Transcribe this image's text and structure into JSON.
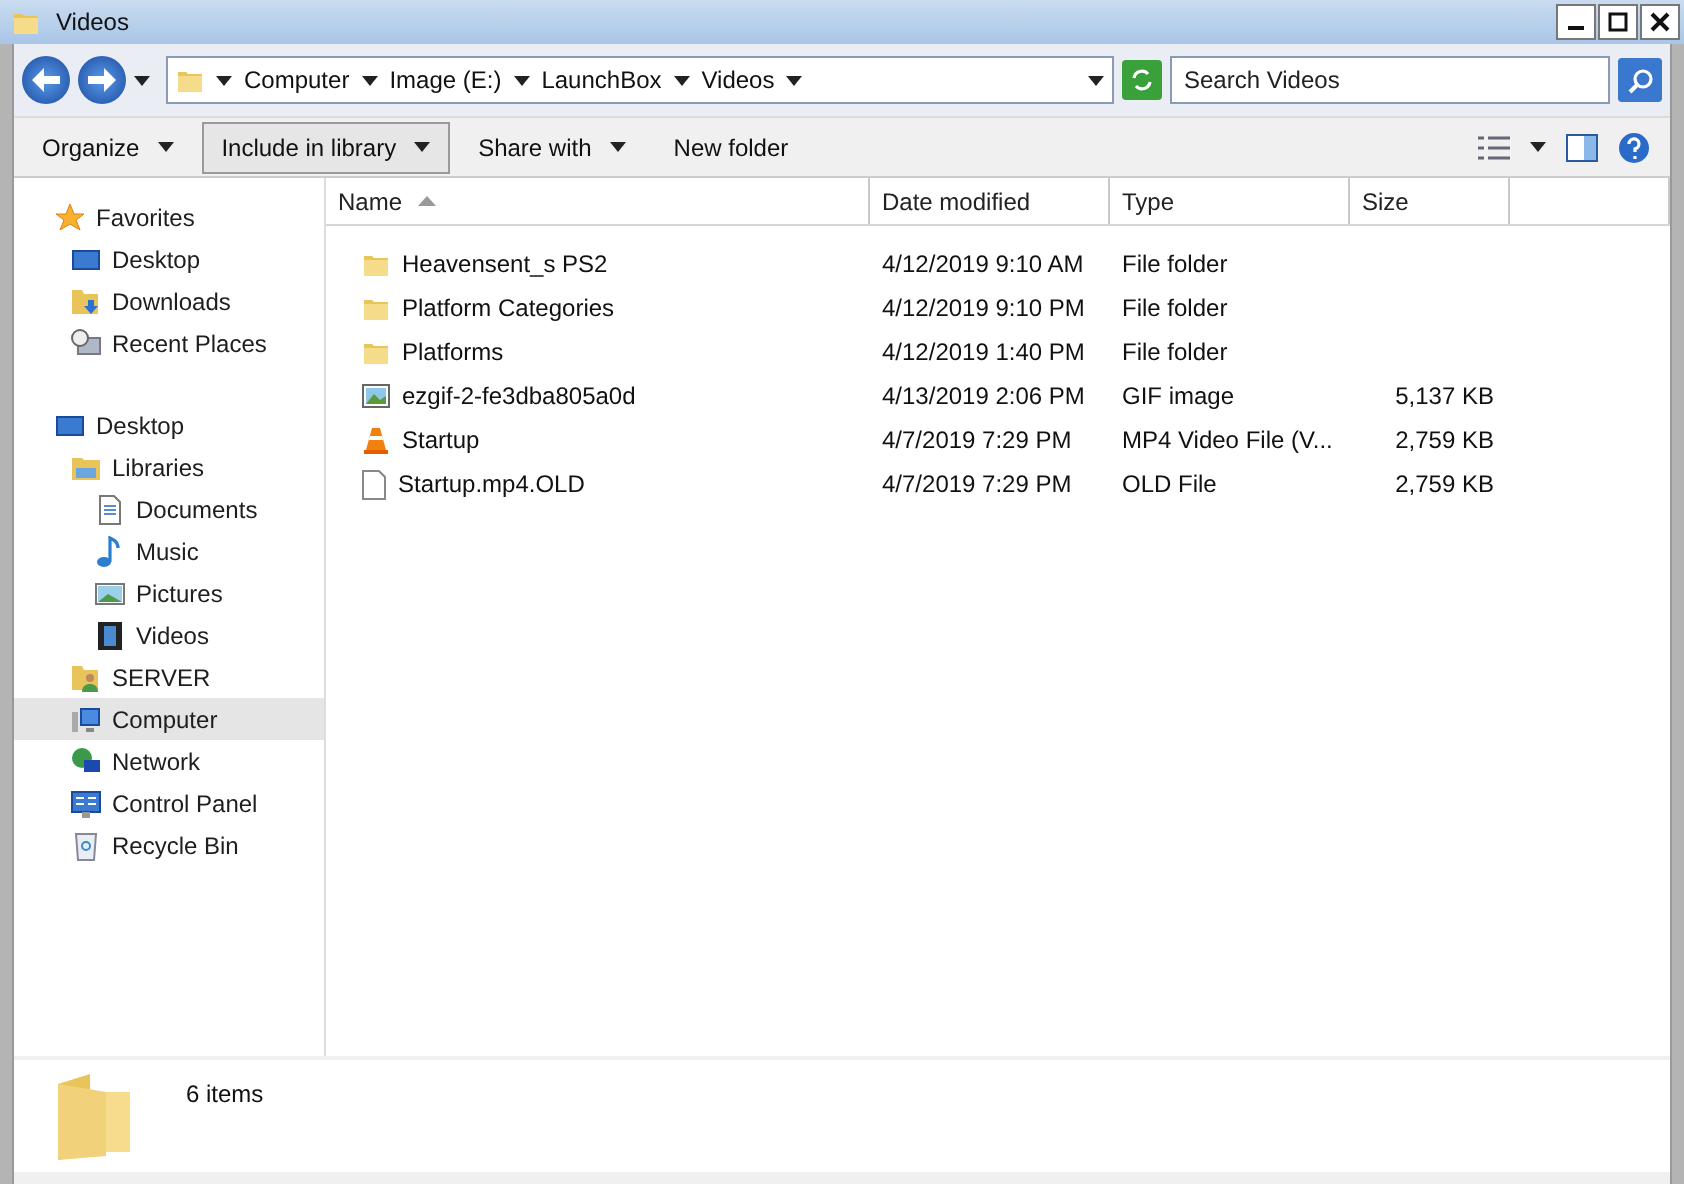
{
  "window": {
    "title": "Videos"
  },
  "address": {
    "crumbs": [
      "Computer",
      "Image (E:)",
      "LaunchBox",
      "Videos"
    ]
  },
  "search": {
    "placeholder": "Search Videos"
  },
  "toolbar": [
    {
      "label": "Organize",
      "menu": true,
      "selected": false
    },
    {
      "label": "Include in library",
      "menu": true,
      "selected": true
    },
    {
      "label": "Share with",
      "menu": true,
      "selected": false
    },
    {
      "label": "New folder",
      "menu": false,
      "selected": false
    }
  ],
  "sidebar": {
    "groups": [
      {
        "label": "Favorites",
        "kind": "star",
        "selected": false,
        "children": [
          {
            "label": "Desktop",
            "kind": "desktop",
            "selected": false
          },
          {
            "label": "Downloads",
            "kind": "downloads",
            "selected": false
          },
          {
            "label": "Recent Places",
            "kind": "recent",
            "selected": false
          }
        ]
      },
      {
        "label": "Desktop",
        "kind": "desktop",
        "selected": false,
        "children": [
          {
            "label": "Libraries",
            "kind": "libraries",
            "selected": false,
            "children": [
              {
                "label": "Documents",
                "kind": "documents",
                "selected": false
              },
              {
                "label": "Music",
                "kind": "music",
                "selected": false
              },
              {
                "label": "Pictures",
                "kind": "pictures",
                "selected": false
              },
              {
                "label": "Videos",
                "kind": "videos",
                "selected": false
              }
            ]
          },
          {
            "label": "SERVER",
            "kind": "user",
            "selected": false
          },
          {
            "label": "Computer",
            "kind": "computer",
            "selected": true
          },
          {
            "label": "Network",
            "kind": "network",
            "selected": false
          },
          {
            "label": "Control Panel",
            "kind": "control",
            "selected": false
          },
          {
            "label": "Recycle Bin",
            "kind": "recycle",
            "selected": false
          }
        ]
      }
    ]
  },
  "table": {
    "columns": [
      {
        "label": "Name",
        "sorted": true
      },
      {
        "label": "Date modified",
        "sorted": false
      },
      {
        "label": "Type",
        "sorted": false
      },
      {
        "label": "Size",
        "sorted": false
      }
    ],
    "rows": [
      {
        "kind": "folder",
        "name": "Heavensent_s PS2",
        "date": "4/12/2019 9:10 AM",
        "type": "File folder",
        "size": ""
      },
      {
        "kind": "folder",
        "name": "Platform Categories",
        "date": "4/12/2019 9:10 PM",
        "type": "File folder",
        "size": ""
      },
      {
        "kind": "folder",
        "name": "Platforms",
        "date": "4/12/2019 1:40 PM",
        "type": "File folder",
        "size": ""
      },
      {
        "kind": "image",
        "name": "ezgif-2-fe3dba805a0d",
        "date": "4/13/2019 2:06 PM",
        "type": "GIF image",
        "size": "5,137 KB"
      },
      {
        "kind": "video",
        "name": "Startup",
        "date": "4/7/2019 7:29 PM",
        "type": "MP4 Video File (V...",
        "size": "2,759 KB"
      },
      {
        "kind": "file",
        "name": "Startup.mp4.OLD",
        "date": "4/7/2019 7:29 PM",
        "type": "OLD File",
        "size": "2,759 KB"
      }
    ]
  },
  "details": {
    "count": "6 items"
  }
}
